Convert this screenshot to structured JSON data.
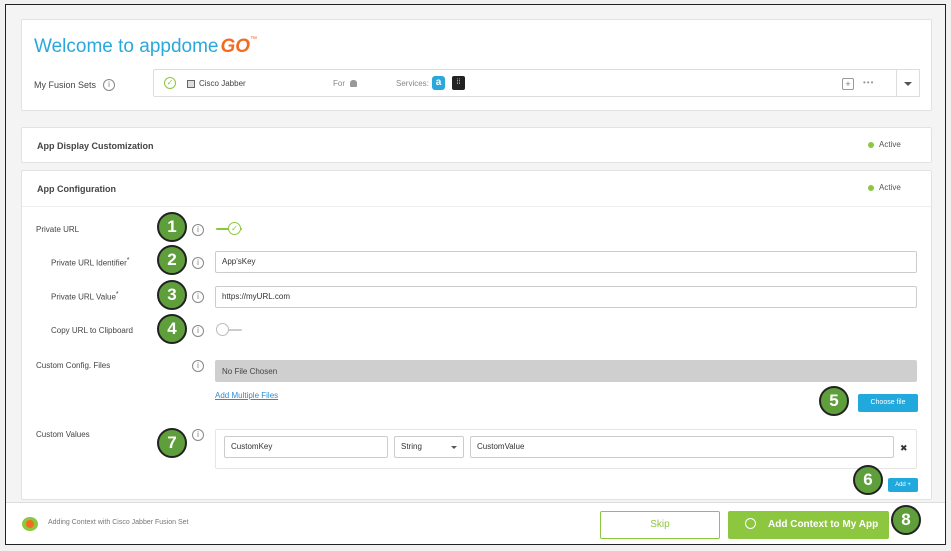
{
  "header": {
    "welcome_prefix": "Welcome to ",
    "brand": "appdome",
    "brand_go": "GO",
    "brand_tm": "™"
  },
  "fusion": {
    "label": "My Fusion Sets",
    "app_name": "Cisco Jabber",
    "for_label": "For",
    "services_label": "Services:",
    "more": "•••"
  },
  "sections": {
    "display": {
      "title": "App Display Customization",
      "status": "Active"
    },
    "config": {
      "title": "App Configuration",
      "status": "Active"
    }
  },
  "form": {
    "private_url": {
      "label": "Private URL"
    },
    "identifier": {
      "label": "Private URL Identifier",
      "required": "*",
      "value": "App'sKey"
    },
    "url_value": {
      "label": "Private URL Value",
      "required": "*",
      "value": "https://myURL.com"
    },
    "clipboard": {
      "label": "Copy URL to Clipboard"
    },
    "config_files": {
      "label": "Custom Config. Files",
      "file_status": "No File Chosen",
      "add_multiple": "Add Multiple Files",
      "choose_button": "Choose file"
    },
    "custom_values": {
      "label": "Custom Values",
      "key": "CustomKey",
      "type": "String",
      "value": "CustomValue",
      "remove": "✖",
      "add_button": "Add +"
    }
  },
  "footer": {
    "context_text": "Adding Context with Cisco Jabber Fusion Set",
    "skip_button": "Skip",
    "add_context_button": "Add Context to My App"
  },
  "callouts": [
    "1",
    "2",
    "3",
    "4",
    "5",
    "6",
    "7",
    "8"
  ],
  "colors": {
    "accent_green": "#8dc63f",
    "brand_blue": "#2aa8db",
    "callout": "#5e9e3b",
    "button_blue": "#21a8dc"
  }
}
